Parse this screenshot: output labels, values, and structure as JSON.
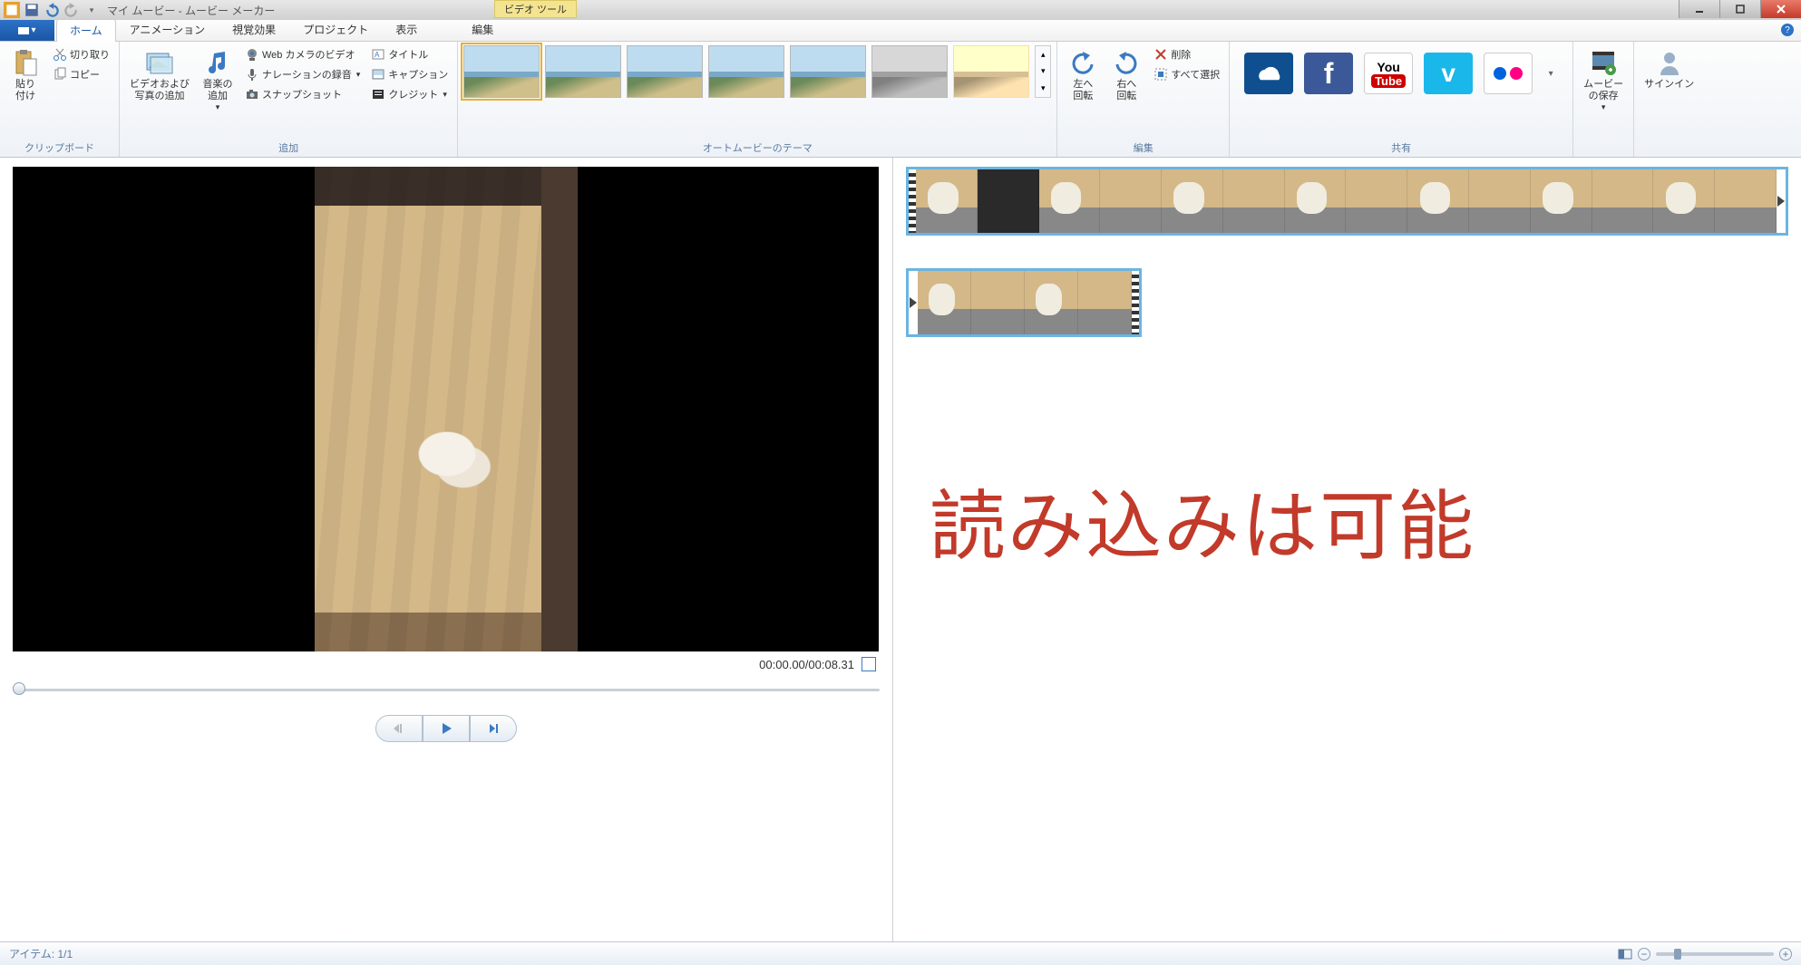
{
  "titlebar": {
    "title": "マイ ムービー - ムービー メーカー",
    "tool_tab": "ビデオ ツール"
  },
  "tabs": {
    "home": "ホーム",
    "animation": "アニメーション",
    "visual": "視覚効果",
    "project": "プロジェクト",
    "view": "表示",
    "edit": "編集"
  },
  "ribbon": {
    "clipboard": {
      "label": "クリップボード",
      "paste": "貼り\n付け",
      "cut": "切り取り",
      "copy": "コピー"
    },
    "add": {
      "label": "追加",
      "video_photo": "ビデオおよび\n写真の追加",
      "music": "音楽の\n追加",
      "webcam": "Web カメラのビデオ",
      "narration": "ナレーションの録音",
      "snapshot": "スナップショット",
      "title": "タイトル",
      "caption": "キャプション",
      "credit": "クレジット"
    },
    "theme": {
      "label": "オートムービーのテーマ"
    },
    "edit": {
      "label": "編集",
      "rotate_left": "左へ\n回転",
      "rotate_right": "右へ\n回転",
      "delete": "削除",
      "select_all": "すべて選択"
    },
    "share": {
      "label": "共有"
    },
    "save": {
      "label": "ムービー\nの保存"
    },
    "signin": {
      "label": "サインイン"
    }
  },
  "preview": {
    "time": "00:00.00/00:08.31"
  },
  "overlay": {
    "text": "読み込みは可能"
  },
  "status": {
    "items": "アイテム: 1/1"
  }
}
